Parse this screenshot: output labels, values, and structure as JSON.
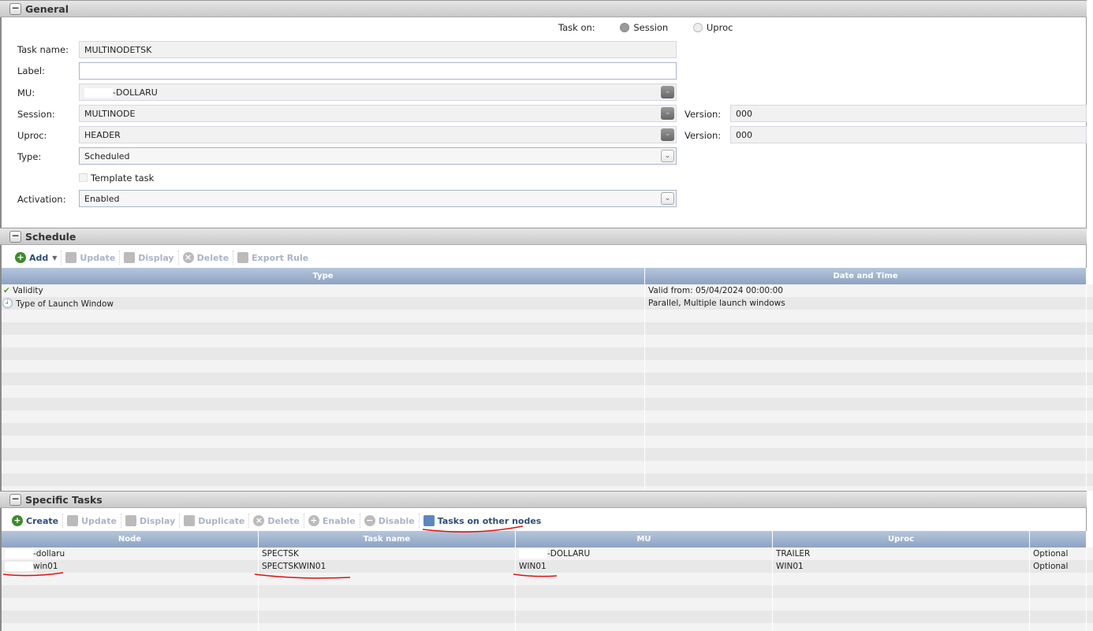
{
  "general": {
    "title": "General",
    "task_on_label": "Task on:",
    "session_radio": "Session",
    "uproc_radio": "Uproc",
    "task_name_label": "Task name:",
    "task_name": "MULTINODETSK",
    "label_label": "Label:",
    "label_value": "",
    "mu_label": "MU:",
    "mu": "-DOLLARU",
    "session_label": "Session:",
    "session": "MULTINODE",
    "version_label": "Version:",
    "session_version": "000",
    "uproc_label": "Uproc:",
    "uproc": "HEADER",
    "uproc_version": "000",
    "type_label": "Type:",
    "type": "Scheduled",
    "template_label": "Template task",
    "activation_label": "Activation:",
    "activation": "Enabled"
  },
  "schedule": {
    "title": "Schedule",
    "toolbar": {
      "add": "Add",
      "update": "Update",
      "display": "Display",
      "delete": "Delete",
      "export": "Export Rule"
    },
    "columns": [
      "Type",
      "Date and Time"
    ],
    "rows": [
      {
        "type": "Validity",
        "value": "Valid from:  05/04/2024 00:00:00"
      },
      {
        "type": "Type of Launch Window",
        "value": "Parallel, Multiple launch windows"
      }
    ]
  },
  "specific": {
    "title": "Specific Tasks",
    "toolbar": {
      "create": "Create",
      "update": "Update",
      "display": "Display",
      "duplicate": "Duplicate",
      "delete": "Delete",
      "enable": "Enable",
      "disable": "Disable",
      "other_nodes": "Tasks on other nodes"
    },
    "columns": [
      "Node",
      "Task name",
      "MU",
      "Uproc",
      ""
    ],
    "rows": [
      {
        "node": "-dollaru",
        "task": "SPECTSK",
        "mu": "-DOLLARU",
        "uproc": "TRAILER",
        "opt": "Optional"
      },
      {
        "node": "win01",
        "task": "SPECTSKWIN01",
        "mu": "WIN01",
        "uproc": "WIN01",
        "opt": "Optional"
      }
    ]
  }
}
